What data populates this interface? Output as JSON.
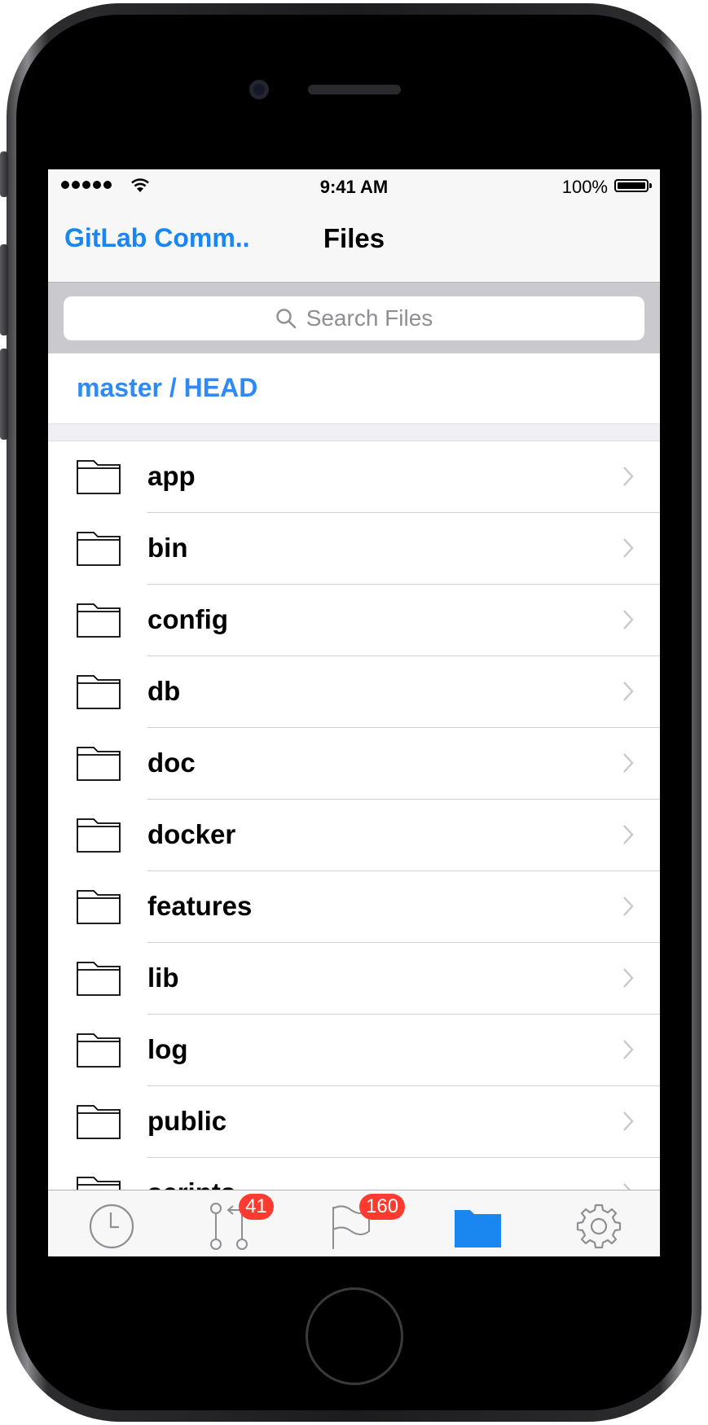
{
  "status_bar": {
    "time": "9:41 AM",
    "battery": "100%"
  },
  "nav": {
    "back_label": "GitLab Comm..",
    "title": "Files"
  },
  "search": {
    "placeholder": "Search Files"
  },
  "branch": {
    "label": "master / HEAD"
  },
  "files": [
    {
      "name": "app",
      "icon": "folder-icon"
    },
    {
      "name": "bin",
      "icon": "folder-icon"
    },
    {
      "name": "config",
      "icon": "folder-icon"
    },
    {
      "name": "db",
      "icon": "folder-icon"
    },
    {
      "name": "doc",
      "icon": "folder-icon"
    },
    {
      "name": "docker",
      "icon": "folder-icon"
    },
    {
      "name": "features",
      "icon": "folder-icon"
    },
    {
      "name": "lib",
      "icon": "folder-icon"
    },
    {
      "name": "log",
      "icon": "folder-icon"
    },
    {
      "name": "public",
      "icon": "folder-icon"
    },
    {
      "name": "scripts",
      "icon": "folder-icon"
    }
  ],
  "tabs": [
    {
      "icon": "clock-icon",
      "badge": ""
    },
    {
      "icon": "merge-request-icon",
      "badge": "41"
    },
    {
      "icon": "flag-icon",
      "badge": "160"
    },
    {
      "icon": "folder-icon",
      "badge": "",
      "selected": true
    },
    {
      "icon": "gear-icon",
      "badge": ""
    }
  ],
  "colors": {
    "accent": "#1a86f0",
    "badge": "#ff3b30",
    "tab_inactive": "#8e8e93"
  }
}
